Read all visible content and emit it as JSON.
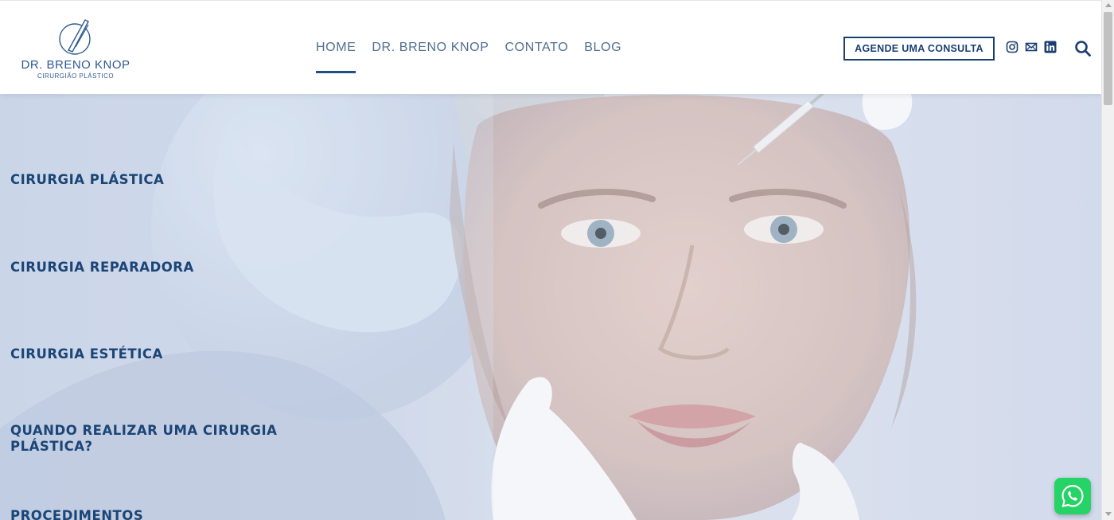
{
  "brand": {
    "name": "DR. BRENO KNOP",
    "tagline": "CIRURGIÃO PLÁSTICO",
    "accent_color": "#1b3f73",
    "nav_color": "#4f6f91"
  },
  "nav": {
    "items": [
      {
        "label": "HOME",
        "active": true
      },
      {
        "label": "DR. BRENO KNOP",
        "active": false
      },
      {
        "label": "CONTATO",
        "active": false
      },
      {
        "label": "BLOG",
        "active": false
      }
    ]
  },
  "header": {
    "cta_label": "AGENDE UMA CONSULTA",
    "social_icons": [
      "instagram-icon",
      "mail-icon",
      "linkedin-icon"
    ],
    "search_icon": "search-icon"
  },
  "hero": {
    "items": [
      "CIRURGIA PLÁSTICA",
      "CIRURGIA REPARADORA",
      "CIRURGIA ESTÉTICA",
      "QUANDO REALIZAR UMA CIRURGIA PLÁSTICA?",
      "PROCEDIMENTOS"
    ]
  },
  "floating": {
    "whatsapp_icon": "whatsapp-icon",
    "whatsapp_color": "#25d366"
  }
}
